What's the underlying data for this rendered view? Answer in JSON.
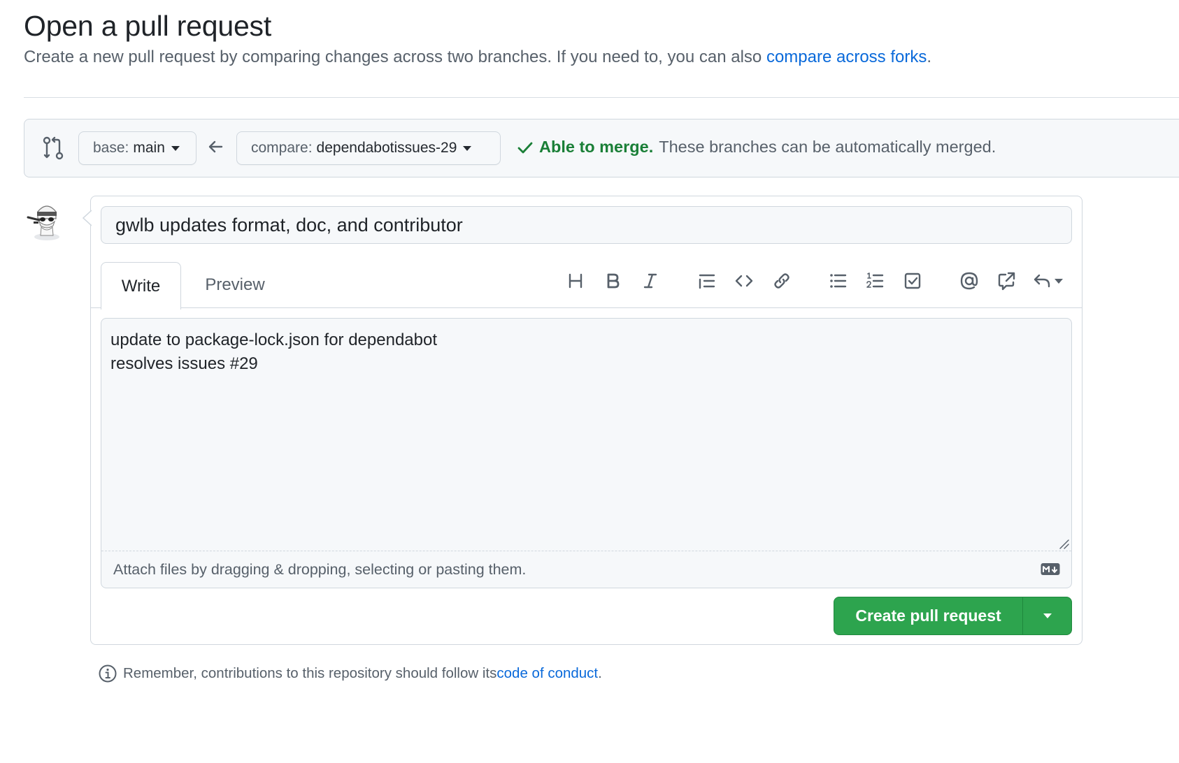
{
  "header": {
    "title": "Open a pull request",
    "subtitle_text": "Create a new pull request by comparing changes across two branches. If you need to, you can also ",
    "subtitle_link": "compare across forks",
    "subtitle_end": "."
  },
  "compare": {
    "base_prefix": "base:",
    "base_branch": "main",
    "compare_prefix": "compare:",
    "compare_branch": "dependabotissues-29",
    "merge_ok": "Able to merge.",
    "merge_desc": "These branches can be automatically merged."
  },
  "composer": {
    "title_value": "gwlb updates format, doc, and contributor",
    "tabs": {
      "write": "Write",
      "preview": "Preview"
    },
    "toolbar": [
      "heading-icon",
      "bold-icon",
      "italic-icon",
      "quote-icon",
      "code-icon",
      "link-icon",
      "unordered-list-icon",
      "ordered-list-icon",
      "task-list-icon",
      "mention-icon",
      "cross-reference-icon",
      "reply-icon"
    ],
    "body_value": "update to package-lock.json for dependabot\nresolves issues #29",
    "attach_text": "Attach files by dragging & dropping, selecting or pasting them.",
    "create_label": "Create pull request"
  },
  "footer": {
    "text": "Remember, contributions to this repository should follow its ",
    "link": "code of conduct",
    "end": "."
  },
  "colors": {
    "accent_link": "#0969da",
    "success": "#1a7f37",
    "primary_button": "#2da44e"
  }
}
